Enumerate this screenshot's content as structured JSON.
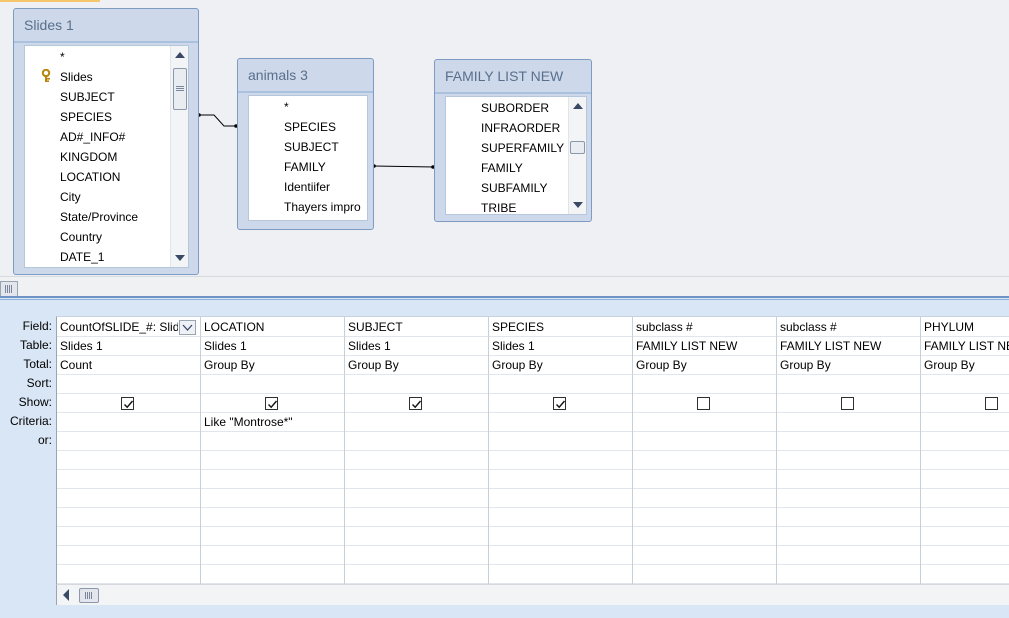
{
  "tables": [
    {
      "title": "Slides 1",
      "fields": [
        {
          "label": "*",
          "key": false
        },
        {
          "label": "Slides",
          "key": true
        },
        {
          "label": "SUBJECT",
          "key": false
        },
        {
          "label": "SPECIES",
          "key": false
        },
        {
          "label": "AD#_INFO#",
          "key": false
        },
        {
          "label": "KINGDOM",
          "key": false
        },
        {
          "label": "LOCATION",
          "key": false
        },
        {
          "label": "City",
          "key": false
        },
        {
          "label": "State/Province",
          "key": false
        },
        {
          "label": "Country",
          "key": false
        },
        {
          "label": "DATE_1",
          "key": false
        }
      ]
    },
    {
      "title": "animals 3",
      "fields": [
        {
          "label": "*",
          "key": false
        },
        {
          "label": "SPECIES",
          "key": false
        },
        {
          "label": "SUBJECT",
          "key": false
        },
        {
          "label": "FAMILY",
          "key": false
        },
        {
          "label": "Identiifer",
          "key": false
        },
        {
          "label": "Thayers impro",
          "key": false
        }
      ]
    },
    {
      "title": "FAMILY LIST NEW",
      "fields": [
        {
          "label": "SUBORDER",
          "key": false
        },
        {
          "label": "INFRAORDER",
          "key": false
        },
        {
          "label": "SUPERFAMILY",
          "key": false
        },
        {
          "label": "FAMILY",
          "key": false
        },
        {
          "label": "SUBFAMILY",
          "key": false
        },
        {
          "label": "TRIBE",
          "key": false
        }
      ]
    }
  ],
  "grid": {
    "row_labels": [
      "Field:",
      "Table:",
      "Total:",
      "Sort:",
      "Show:",
      "Criteria:",
      "or:"
    ],
    "columns": [
      {
        "field": "CountOfSLIDE_#: Slide",
        "table": "Slides 1",
        "total": "Count",
        "sort": "",
        "show": true,
        "criteria": "",
        "or": ""
      },
      {
        "field": "LOCATION",
        "table": "Slides 1",
        "total": "Group By",
        "sort": "",
        "show": true,
        "criteria": "Like \"Montrose*\"",
        "or": ""
      },
      {
        "field": "SUBJECT",
        "table": "Slides 1",
        "total": "Group By",
        "sort": "",
        "show": true,
        "criteria": "",
        "or": ""
      },
      {
        "field": "SPECIES",
        "table": "Slides 1",
        "total": "Group By",
        "sort": "",
        "show": true,
        "criteria": "",
        "or": ""
      },
      {
        "field": "subclass #",
        "table": "FAMILY LIST NEW",
        "total": "Group By",
        "sort": "",
        "show": false,
        "criteria": "",
        "or": ""
      },
      {
        "field": "subclass #",
        "table": "FAMILY LIST NEW",
        "total": "Group By",
        "sort": "",
        "show": false,
        "criteria": "",
        "or": ""
      },
      {
        "field": "PHYLUM",
        "table": "FAMILY LIST NEW",
        "total": "Group By",
        "sort": "",
        "show": false,
        "criteria": "",
        "or": ""
      }
    ]
  },
  "colors": {
    "table_border": "#7d9bc3",
    "grid_band": "#d9e6f5",
    "key_icon": "#d4a017"
  }
}
